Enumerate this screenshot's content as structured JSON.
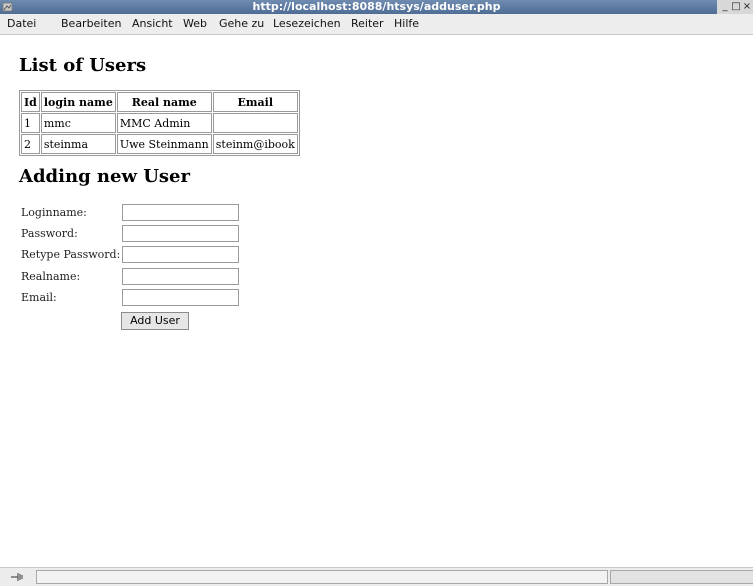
{
  "window": {
    "title": "http://localhost:8088/htsys/adduser.php",
    "controls": [
      "_",
      "□",
      "×"
    ]
  },
  "menu": [
    "Datei",
    "Bearbeiten",
    "Ansicht",
    "Web",
    "Gehe zu",
    "Lesezeichen",
    "Reiter",
    "Hilfe"
  ],
  "users_section": {
    "heading": "List of Users",
    "columns": [
      "Id",
      "login name",
      "Real name",
      "Email"
    ],
    "rows": [
      [
        "1",
        "mmc",
        "MMC Admin",
        ""
      ],
      [
        "2",
        "steinma",
        "Uwe Steinmann",
        "steinm@ibook"
      ]
    ]
  },
  "add_section": {
    "heading": "Adding new User",
    "labels": {
      "loginname": "Loginname:",
      "password": "Password:",
      "retype": "Retype Password:",
      "realname": "Realname:",
      "email": "Email:"
    },
    "values": {
      "loginname": "",
      "password": "",
      "retype": "",
      "realname": "",
      "email": ""
    },
    "button": "Add User"
  },
  "colors": {
    "titlebar": "#4e6c95",
    "menubar": "#ededed",
    "border": "#9a9a9a"
  }
}
